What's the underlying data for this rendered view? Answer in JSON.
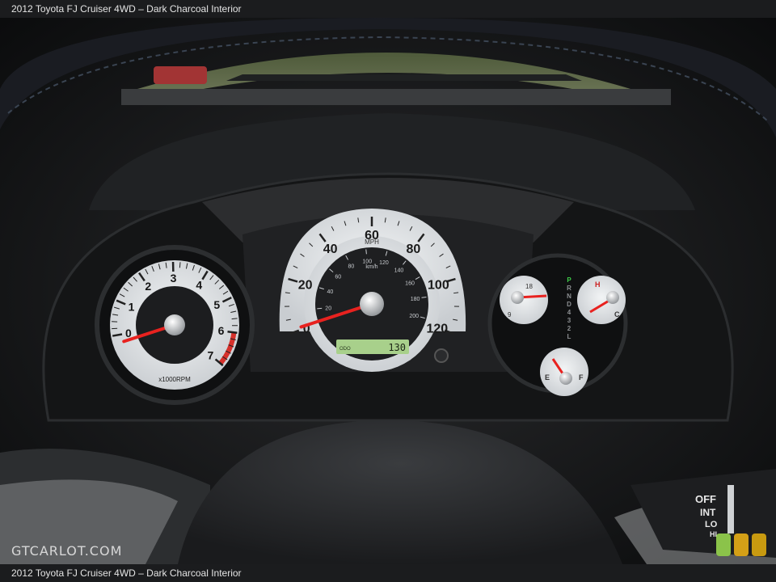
{
  "caption": {
    "top": "2012 Toyota FJ Cruiser 4WD – Dark Charcoal Interior",
    "bottom": "2012 Toyota FJ Cruiser 4WD – Dark Charcoal Interior"
  },
  "watermark": "GTCARLOT.COM",
  "tachometer": {
    "ticks": [
      "0",
      "1",
      "2",
      "3",
      "4",
      "5",
      "6",
      "7"
    ],
    "unit": "x1000RPM",
    "needle_value": 0
  },
  "speedometer": {
    "mph_ticks": [
      "0",
      "20",
      "40",
      "60",
      "80",
      "100",
      "120"
    ],
    "mph_unit": "MPH",
    "kmh_ticks": [
      "20",
      "40",
      "60",
      "80",
      "100",
      "120",
      "140",
      "160",
      "180",
      "200"
    ],
    "kmh_unit": "km/h",
    "needle_value": 0,
    "odometer_label": "ODO",
    "odometer_value": "130"
  },
  "voltmeter": {
    "low": "9",
    "high": "18"
  },
  "temperature": {
    "high": "H",
    "low": "C"
  },
  "fuel": {
    "empty": "E",
    "full": "F"
  },
  "gear_indicator": [
    "P",
    "R",
    "N",
    "D",
    "4",
    "3",
    "2",
    "L"
  ],
  "wiper_stalk": [
    "OFF",
    "INT",
    "LO",
    "HI"
  ],
  "colors": {
    "needle": "#e8221f",
    "face": "#e8ebed",
    "redline": "#d6312b",
    "gear_active": "#3fd04a"
  }
}
